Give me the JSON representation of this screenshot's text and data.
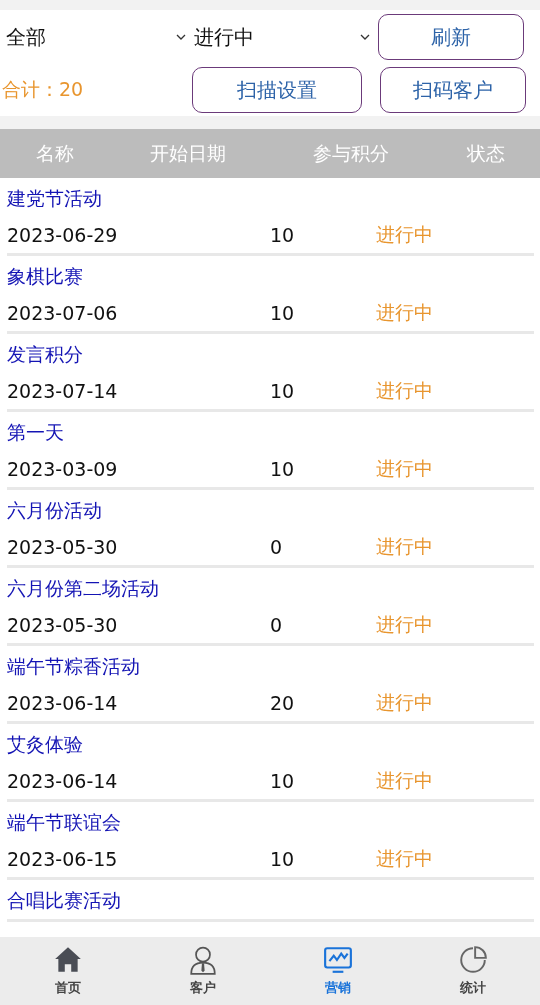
{
  "filters": [
    {
      "value": "全部"
    },
    {
      "value": "进行中"
    }
  ],
  "buttons": [
    "刷新",
    "扫描设置",
    "扫码客户"
  ],
  "total": "合计：20",
  "table": {
    "columns": [
      "名称",
      "开始日期",
      "参与积分",
      "状态"
    ],
    "rows": [
      {
        "name": "建党节活动",
        "date": "2023-06-29",
        "points": "10",
        "status": "进行中"
      },
      {
        "name": "象棋比赛",
        "date": "2023-07-06",
        "points": "10",
        "status": "进行中"
      },
      {
        "name": "发言积分",
        "date": "2023-07-14",
        "points": "10",
        "status": "进行中"
      },
      {
        "name": "第一天",
        "date": "2023-03-09",
        "points": "10",
        "status": "进行中"
      },
      {
        "name": "六月份活动",
        "date": "2023-05-30",
        "points": "0",
        "status": "进行中"
      },
      {
        "name": "六月份第二场活动",
        "date": "2023-05-30",
        "points": "0",
        "status": "进行中"
      },
      {
        "name": "端午节粽香活动",
        "date": "2023-06-14",
        "points": "20",
        "status": "进行中"
      },
      {
        "name": "艾灸体验",
        "date": "2023-06-14",
        "points": "10",
        "status": "进行中"
      },
      {
        "name": "端午节联谊会",
        "date": "2023-06-15",
        "points": "10",
        "status": "进行中"
      },
      {
        "name": "合唱比赛活动"
      }
    ]
  },
  "tab_bar": [
    {
      "kind": "home",
      "label": "首页",
      "selected": false
    },
    {
      "kind": "person",
      "label": "客户",
      "selected": false
    },
    {
      "kind": "chart",
      "label": "营销",
      "selected": true
    },
    {
      "kind": "pie",
      "label": "统计",
      "selected": false
    }
  ]
}
